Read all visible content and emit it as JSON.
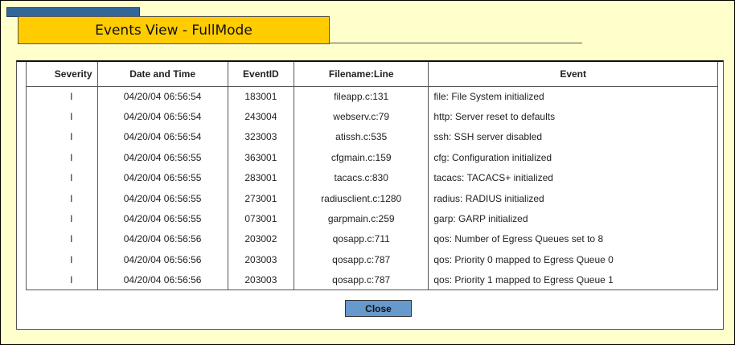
{
  "title": "Events View - FullMode",
  "columns": [
    "Severity",
    "Date and Time",
    "EventID",
    "Filename:Line",
    "Event"
  ],
  "rows": [
    [
      "I",
      "04/20/04 06:56:54",
      "183001",
      "fileapp.c:131",
      "file: File System initialized"
    ],
    [
      "I",
      "04/20/04 06:56:54",
      "243004",
      "webserv.c:79",
      "http: Server reset to defaults"
    ],
    [
      "I",
      "04/20/04 06:56:54",
      "323003",
      "atissh.c:535",
      "ssh: SSH server disabled"
    ],
    [
      "I",
      "04/20/04 06:56:55",
      "363001",
      "cfgmain.c:159",
      "cfg: Configuration initialized"
    ],
    [
      "I",
      "04/20/04 06:56:55",
      "283001",
      "tacacs.c:830",
      "tacacs: TACACS+ initialized"
    ],
    [
      "I",
      "04/20/04 06:56:55",
      "273001",
      "radiusclient.c:1280",
      "radius: RADIUS initialized"
    ],
    [
      "I",
      "04/20/04 06:56:55",
      "073001",
      "garpmain.c:259",
      "garp: GARP initialized"
    ],
    [
      "I",
      "04/20/04 06:56:56",
      "203002",
      "qosapp.c:711",
      "qos: Number of Egress Queues set to 8"
    ],
    [
      "I",
      "04/20/04 06:56:56",
      "203003",
      "qosapp.c:787",
      "qos: Priority 0 mapped to Egress Queue 0"
    ],
    [
      "I",
      "04/20/04 06:56:56",
      "203003",
      "qosapp.c:787",
      "qos: Priority 1 mapped to Egress Queue 1"
    ]
  ],
  "close_label": "Close"
}
